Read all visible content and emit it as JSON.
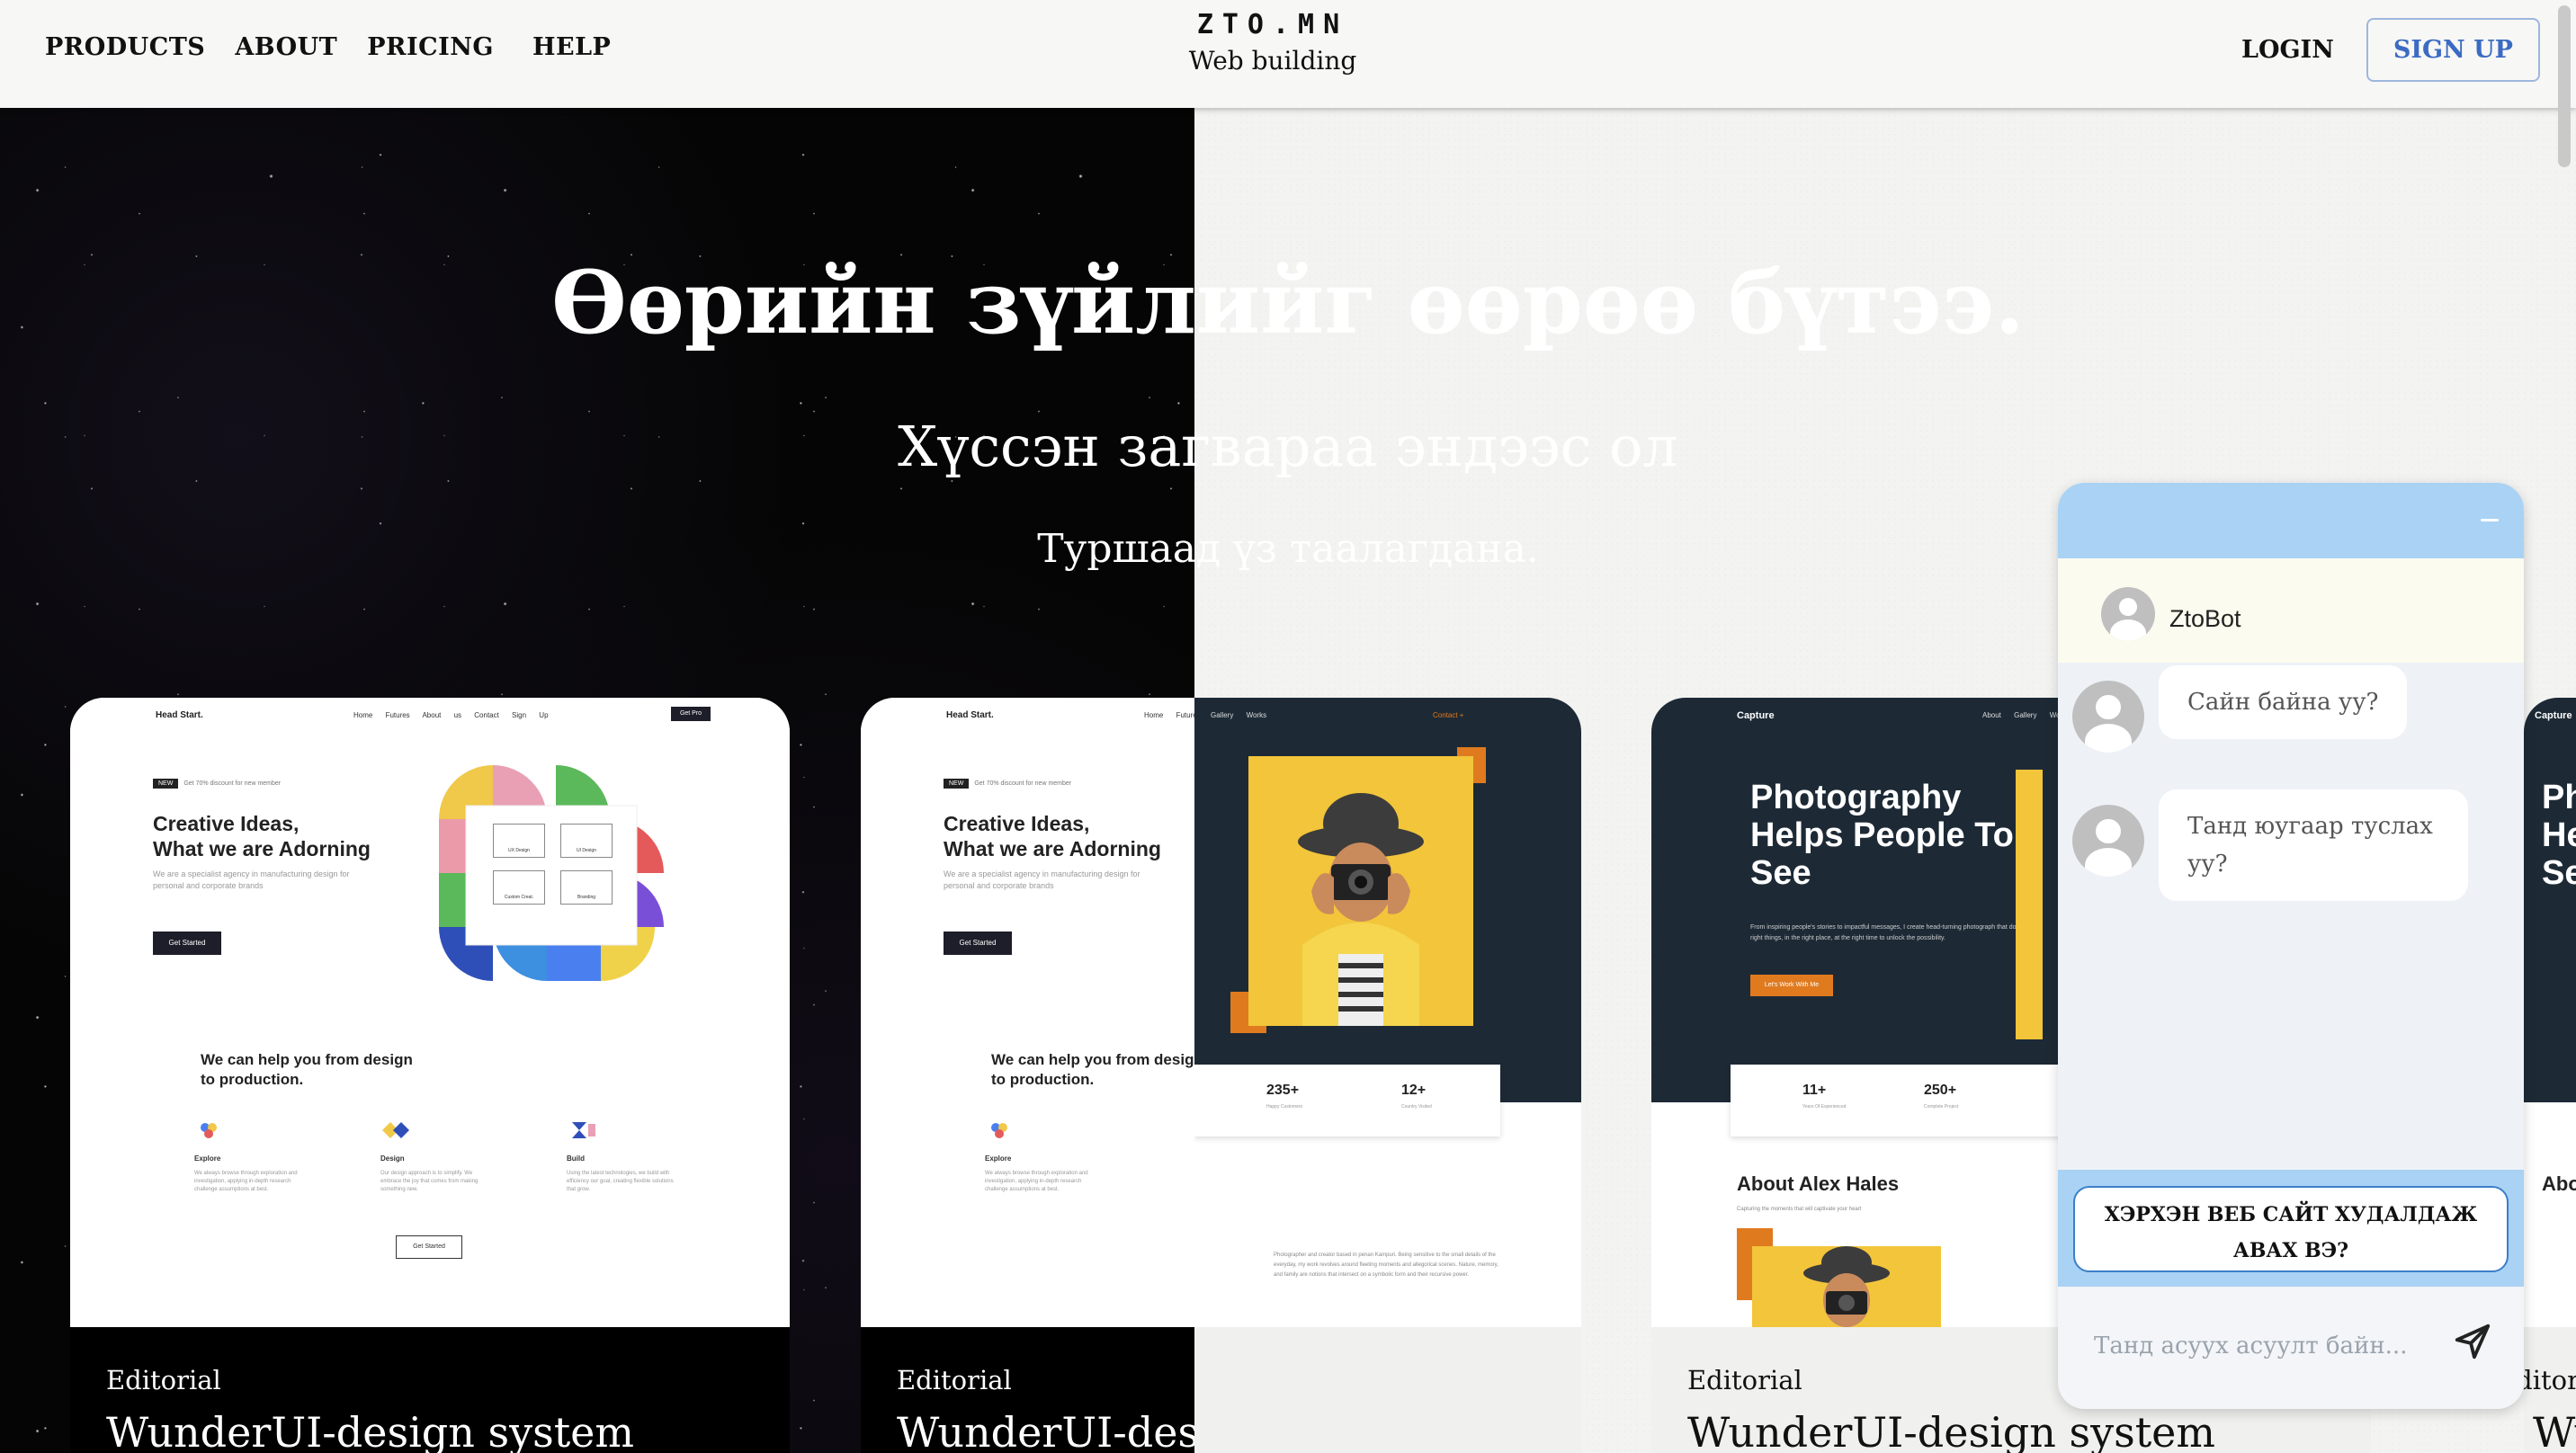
{
  "header": {
    "nav": [
      "PRODUCTS",
      "ABOUT",
      "PRICING",
      "HELP"
    ],
    "brand": "ZTO.MN",
    "brand_sub": "Web building",
    "login": "LOGIN",
    "signup": "SIGN UP"
  },
  "hero": {
    "title": "Өөрийн зүйлийг өөрөө бүтээ.",
    "subtitle": "Хүссэн загвараа эндээс ол",
    "note": "Туршаад үз таалагдана."
  },
  "cards": [
    {
      "category": "Editorial",
      "name": "WunderUI-design system",
      "preview": {
        "brand": "Head Start.",
        "menu": "Home Futures About us Contact Sign Up",
        "cta": "Get Pro",
        "tag_badge": "NEW",
        "tag": "Get 70% discount for new member",
        "heading_1": "Creative Ideas,",
        "heading_2": "What we are Adorning",
        "paragraph": "We are a specialist agency in manufacturing design for personal and corporate brands",
        "button": "Get Started",
        "tiles": [
          "UX Design",
          "UI Design",
          "Custom Creat.",
          "Branding"
        ],
        "heading2_1": "We can help you from design",
        "heading2_2": "to production.",
        "features": [
          {
            "title": "Explore",
            "text": "We always browse through exploration and investigation, applying in-depth research challenge assumptions at best."
          },
          {
            "title": "Design",
            "text": "Our design approach is to simplify. We embrace the joy that comes from making something new."
          },
          {
            "title": "Build",
            "text": "Using the latest technologies, we build with efficiency our goal, creating flexible solutions that grow."
          }
        ],
        "button2": "Get Started"
      }
    },
    {
      "category": "Editorial",
      "name": "WunderUI-design system",
      "preview_ref": "head-start"
    },
    {
      "category": "",
      "name": "",
      "preview": {
        "menu": "Gallery Works",
        "contact": "Contact +",
        "stat_1": "235+",
        "stat_1_label": "Happy Customers",
        "stat_2": "12+",
        "stat_2_label": "Country Visited",
        "paragraph": "Photographer and creator based in penan Kampuri. Being sensitive to the small details of the everyday, my work revolves around fleeting moments and allegorical scenes. Nature, memory, and family are notions that intersect on a symbolic form and their recursive power."
      }
    },
    {
      "category": "Editorial",
      "name": "WunderUI-design system",
      "preview": {
        "brand": "Capture",
        "menu": "About Gallery Works",
        "heading_1": "Photography",
        "heading_2": "Helps People To",
        "heading_3": "See",
        "paragraph": "From inspiring people's stories to impactful messages, I create head-turning photograph that does the right things, in the right place, at the right time to unlock the possibility.",
        "button": "Let's Work With Me",
        "stat_1": "11+",
        "stat_1_label": "Years Of Experienced",
        "stat_2": "250+",
        "stat_2_label": "Complete Project",
        "about": "About Alex Hales",
        "about_sub": "Capturing the moments that will captivate your heart"
      }
    },
    {
      "category": "Editorial",
      "name": "WunderUI-design system",
      "preview": {
        "brand": "Capture",
        "heading": "Ph He Se",
        "about": "Abou"
      }
    }
  ],
  "chat": {
    "bot_name": "ZtoBot",
    "messages": [
      "Сайн байна уу?",
      "Танд юугаар туслах уу?"
    ],
    "quick_reply": "ХЭРХЭН ВЕБ САЙТ ХУДАЛДАЖ АВАХ ВЭ?",
    "input_placeholder": "Танд асуух асуулт байн..."
  },
  "colors": {
    "signup_text": "#3b6bc2",
    "chat_header": "#a9d2f4",
    "chat_bot_bar": "#fbfbef",
    "quick_reply_border": "#3c7fc8",
    "photo_dark": "#1d2a36",
    "photo_accent": "#e07a1f",
    "photo_yellow": "#f2c53a"
  },
  "icons": [
    "bot-avatar-icon",
    "user-avatar-icon",
    "minimize-icon",
    "send-icon"
  ]
}
